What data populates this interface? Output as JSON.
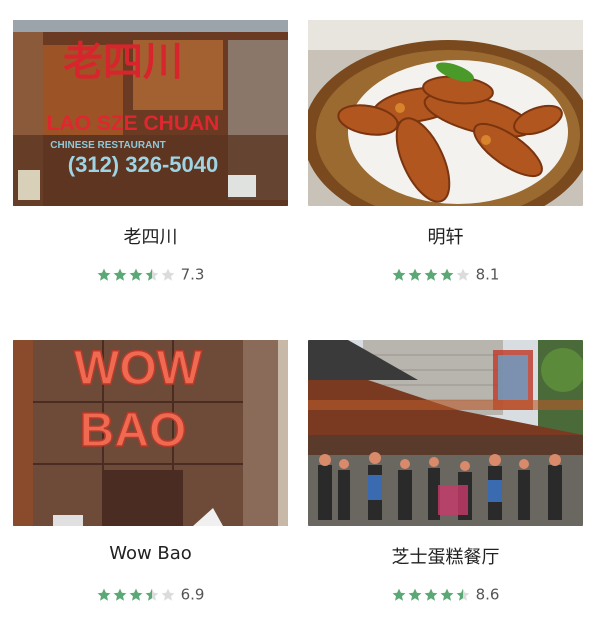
{
  "colors": {
    "star_on": "#5aa874",
    "star_off": "#dcdcdc",
    "text": "#222222",
    "score_text": "#555555"
  },
  "cards": [
    {
      "name": "老四川",
      "rating": 3.5,
      "score": "7.3",
      "photo": {
        "sign_cn": "老四川",
        "sign_en": "LAO SZE CHUAN",
        "sign_sub": "CHINESE RESTAURANT",
        "phone": "(312) 326-5040"
      }
    },
    {
      "name": "明轩",
      "rating": 4,
      "score": "8.1",
      "photo": {}
    },
    {
      "name": "Wow Bao",
      "rating": 3.5,
      "score": "6.9",
      "photo": {
        "sign_top": "WOW",
        "sign_bottom": "BAO"
      }
    },
    {
      "name": "芝士蛋糕餐厅",
      "rating": 4.5,
      "score": "8.6",
      "photo": {}
    }
  ]
}
